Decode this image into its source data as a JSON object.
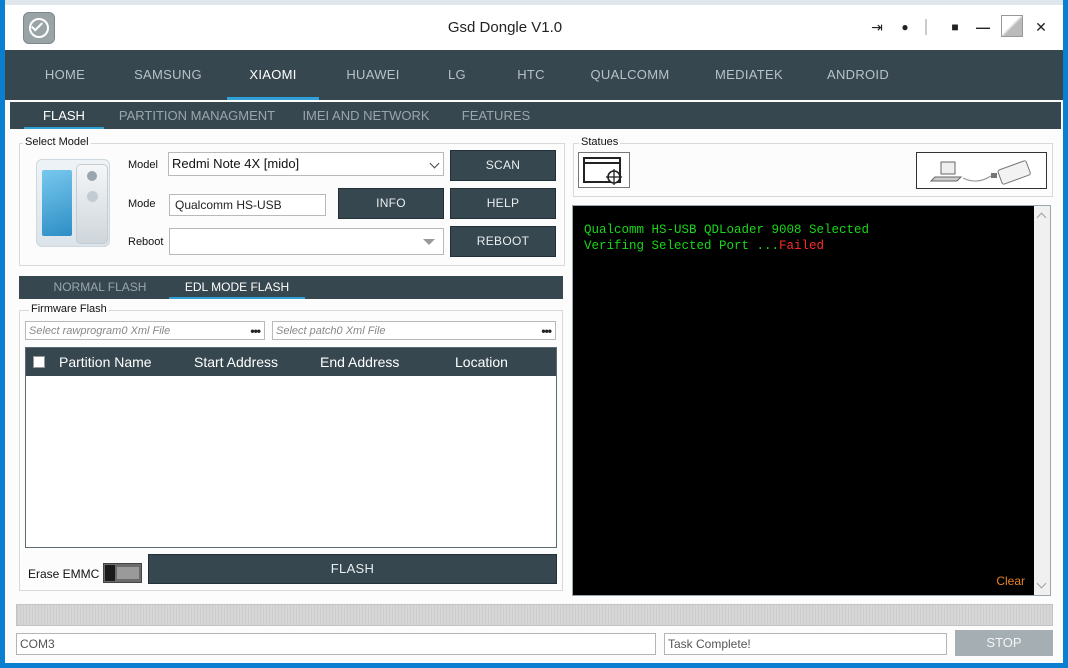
{
  "app": {
    "title": "Gsd Dongle V1.0"
  },
  "titlebar_icons": [
    "login-icon",
    "user-icon",
    "chat-icon",
    "minimize-icon",
    "maximize-icon",
    "close-icon"
  ],
  "titlebar_glyphs": {
    "login": "⇥",
    "user": "●",
    "chat": "■",
    "minimize": "—",
    "close": "✕"
  },
  "main_tabs": [
    "HOME",
    "SAMSUNG",
    "XIAOMI",
    "HUAWEI",
    "LG",
    "HTC",
    "QUALCOMM",
    "MEDIATEK",
    "ANDROID"
  ],
  "main_tab_active": "XIAOMI",
  "sub_tabs": [
    "FLASH",
    "PARTITION MANAGMENT",
    "IMEI AND NETWORK",
    "FEATURES"
  ],
  "sub_tab_active": "FLASH",
  "select_model": {
    "group_label": "Select Model",
    "model_label": "Model",
    "model_value": "Redmi Note 4X [mido]",
    "mode_label": "Mode",
    "mode_value": "Qualcomm HS-USB",
    "reboot_label": "Reboot",
    "reboot_value": "",
    "buttons": {
      "scan": "SCAN",
      "info": "INFO",
      "help": "HELP",
      "reboot": "REBOOT"
    }
  },
  "flash_tabs": [
    "NORMAL FLASH",
    "EDL MODE FLASH"
  ],
  "flash_tab_active": "EDL MODE FLASH",
  "firmware": {
    "group_label": "Firmware Flash",
    "rawprogram_placeholder": "Select rawprogram0 Xml File",
    "patch_placeholder": "Select patch0 Xml File",
    "browse_label": "•••",
    "columns": [
      "Partition Name",
      "Start Address",
      "End Address",
      "Location"
    ],
    "rows": []
  },
  "erase_emmc_label": "Erase EMMC",
  "erase_emmc_on": false,
  "flash_button": "FLASH",
  "statues": {
    "group_label": "Statues",
    "console_lines": [
      {
        "text": "Qualcomm HS-USB QDLoader 9008 Selected",
        "suffix": ""
      },
      {
        "text": "Verifing Selected Port ...",
        "suffix": "Failed"
      }
    ],
    "clear_label": "Clear",
    "colors": {
      "ok": "#18d818",
      "fail": "#ff2a2a",
      "clear": "#e6822a"
    }
  },
  "status_bar": {
    "port": "COM3",
    "task": "Task Complete!",
    "stop_label": "STOP"
  },
  "colors": {
    "nav_bg": "#37474f",
    "accent": "#31a2d8",
    "frame": "#0a7fd0"
  }
}
